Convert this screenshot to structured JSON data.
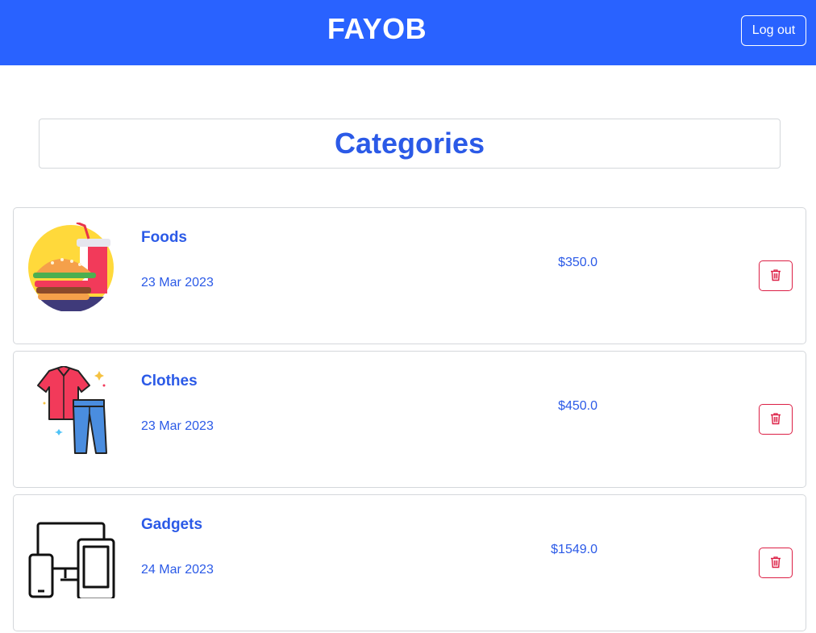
{
  "header": {
    "brand": "FAYOB",
    "logout_label": "Log out",
    "background_color": "#2962ff"
  },
  "main": {
    "title": "Categories",
    "categories": [
      {
        "name": "Foods",
        "date": "23 Mar 2023",
        "amount": "$350.0",
        "icon": "burger-drink-icon"
      },
      {
        "name": "Clothes",
        "date": "23 Mar 2023",
        "amount": "$450.0",
        "icon": "shirt-jeans-icon"
      },
      {
        "name": "Gadgets",
        "date": "24 Mar 2023",
        "amount": "$1549.0",
        "icon": "devices-icon"
      }
    ],
    "delete_icon": "trash-icon",
    "accent_color": "#2b5ae7",
    "danger_color": "#dc1f45"
  }
}
